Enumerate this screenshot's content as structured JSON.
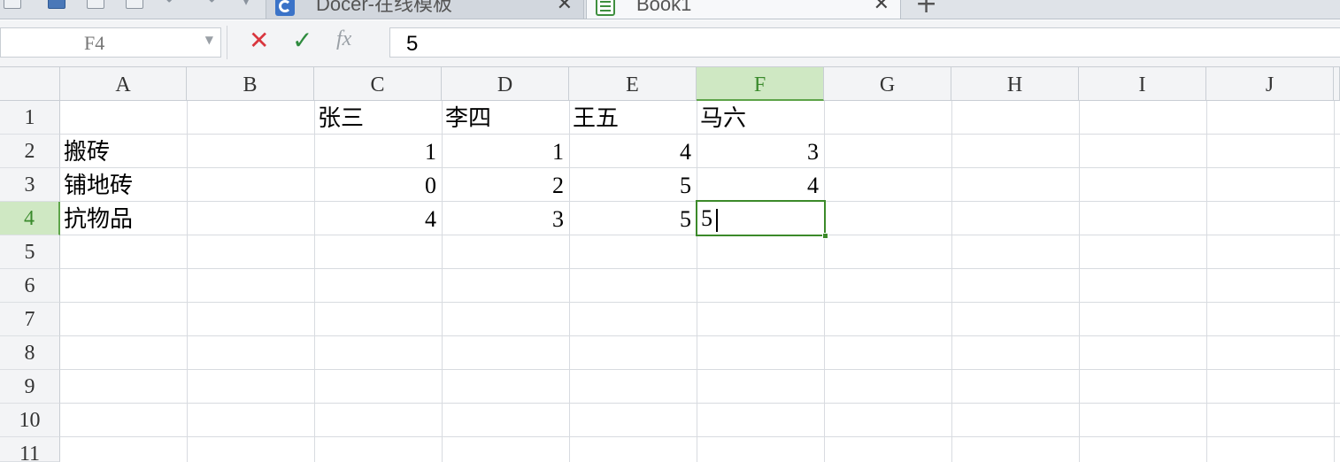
{
  "tabs": [
    {
      "label": "Docer-在线模板",
      "close": "✕"
    },
    {
      "label": "Book1",
      "close": "✕"
    }
  ],
  "new_tab": "+",
  "formula_bar": {
    "name_box": "F4",
    "cancel": "✕",
    "confirm": "✓",
    "fx": "fx",
    "value": "5"
  },
  "columns": [
    "A",
    "B",
    "C",
    "D",
    "E",
    "F",
    "G",
    "H",
    "I",
    "J"
  ],
  "rows": [
    "1",
    "2",
    "3",
    "4",
    "5",
    "6",
    "7",
    "8",
    "9",
    "10",
    "11"
  ],
  "active_cell": {
    "col": "F",
    "row": "4",
    "editing_value": "5"
  },
  "sheet": {
    "r1": {
      "C": "张三",
      "D": "李四",
      "E": "王五",
      "F": "马六"
    },
    "r2": {
      "A": "搬砖",
      "C": "1",
      "D": "1",
      "E": "4",
      "F": "3"
    },
    "r3": {
      "A": "铺地砖",
      "C": "0",
      "D": "2",
      "E": "5",
      "F": "4"
    },
    "r4": {
      "A": "抗物品",
      "C": "4",
      "D": "3",
      "E": "5"
    }
  },
  "colors": {
    "selection": "#3c8a2a",
    "header_active": "#cfe8c3",
    "cancel": "#d9363e",
    "confirm": "#2e8b3e"
  }
}
